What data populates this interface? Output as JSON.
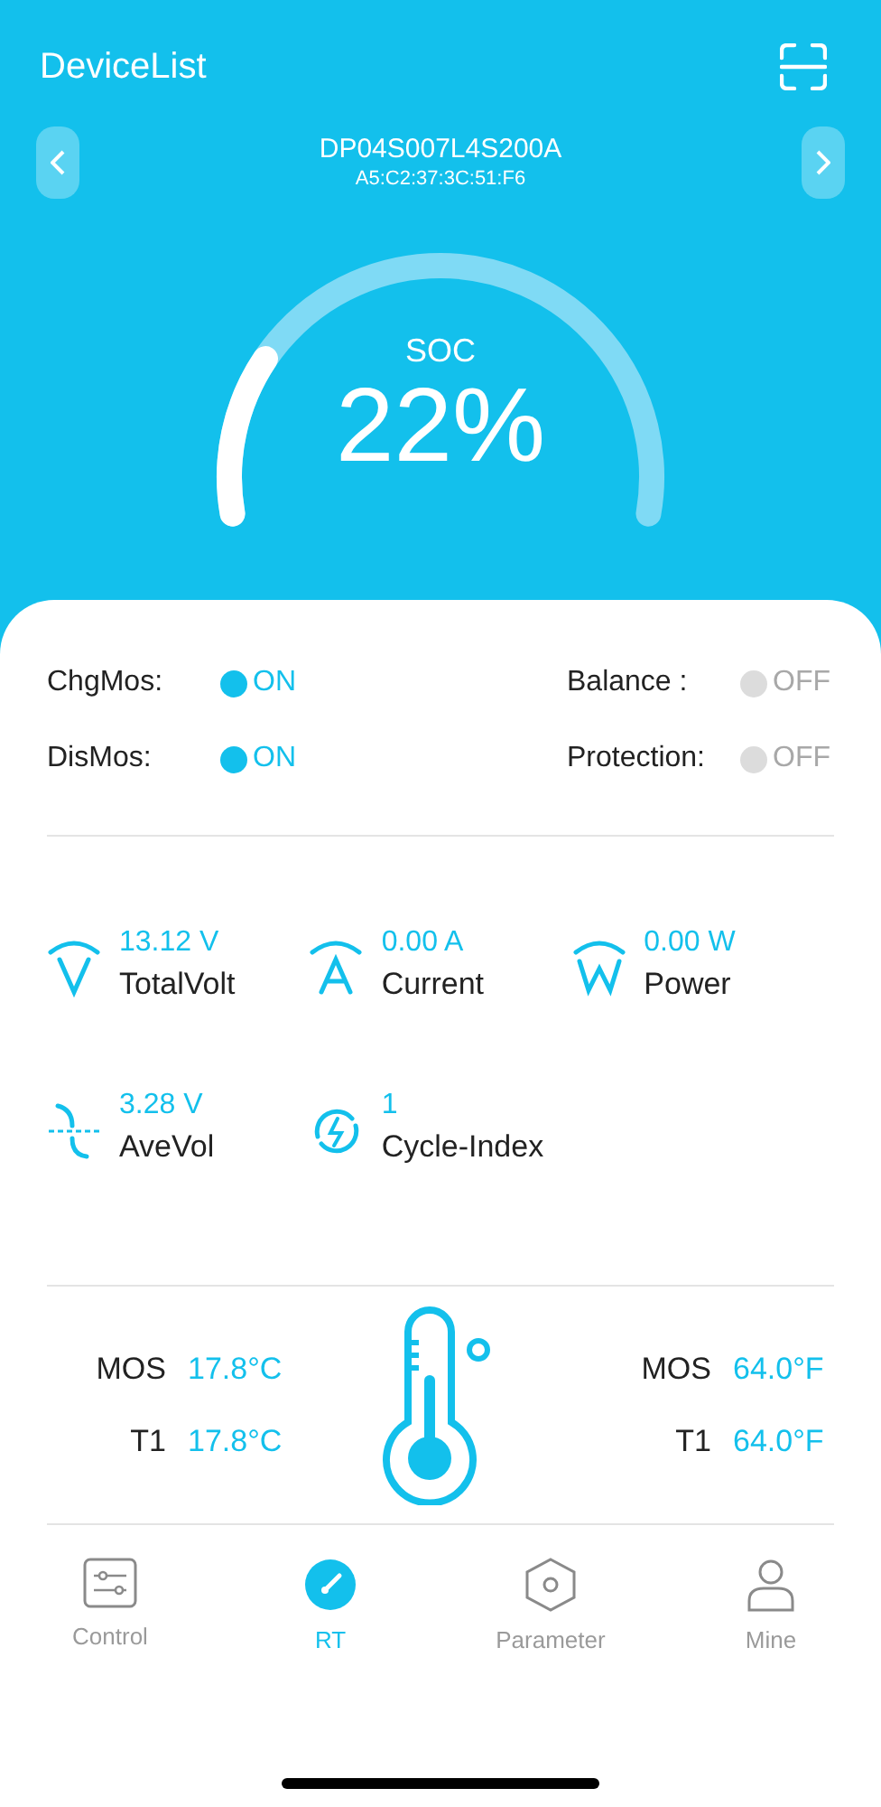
{
  "header": {
    "title": "DeviceList"
  },
  "device": {
    "name": "DP04S007L4S200A",
    "mac": "A5:C2:37:3C:51:F6"
  },
  "gauge": {
    "label": "SOC",
    "value": "22%"
  },
  "switches": [
    {
      "label": "ChgMos:",
      "state": "ON",
      "on": true
    },
    {
      "label": "Balance :",
      "state": "OFF",
      "on": false
    },
    {
      "label": "DisMos:",
      "state": "ON",
      "on": true
    },
    {
      "label": "Protection:",
      "state": "OFF",
      "on": false
    }
  ],
  "metrics": [
    {
      "kind": "volt",
      "value": "13.12 V",
      "label": "TotalVolt"
    },
    {
      "kind": "amp",
      "value": "0.00 A",
      "label": "Current"
    },
    {
      "kind": "watt",
      "value": "0.00 W",
      "label": "Power"
    },
    {
      "kind": "avg",
      "value": "3.28 V",
      "label": "AveVol"
    },
    {
      "kind": "cycle",
      "value": "1",
      "label": "Cycle-Index"
    }
  ],
  "temps_c": [
    {
      "label": "MOS",
      "value": "17.8°C"
    },
    {
      "label": "T1",
      "value": "17.8°C"
    }
  ],
  "temps_f": [
    {
      "label": "MOS",
      "value": "64.0°F"
    },
    {
      "label": "T1",
      "value": "64.0°F"
    }
  ],
  "tabs": [
    {
      "kind": "control",
      "label": "Control",
      "selected": false
    },
    {
      "kind": "rt",
      "label": "RT",
      "selected": true
    },
    {
      "kind": "parameter",
      "label": "Parameter",
      "selected": false
    },
    {
      "kind": "mine",
      "label": "Mine",
      "selected": false
    }
  ]
}
